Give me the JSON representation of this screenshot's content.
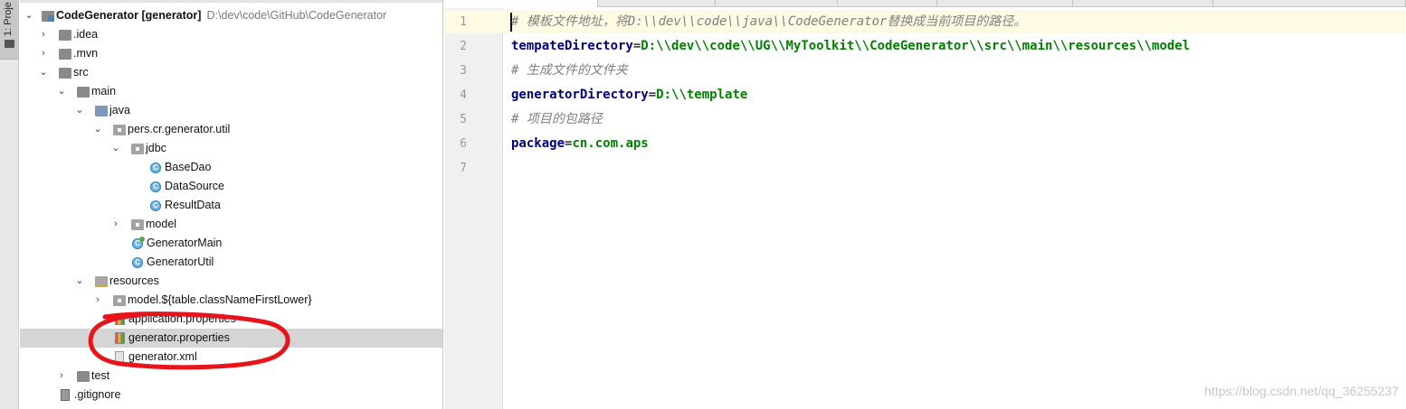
{
  "toolstrip": {
    "project_tab_label": "1: Proje"
  },
  "tree": {
    "root": {
      "name": "CodeGenerator",
      "module": "[generator]",
      "path": "D:\\dev\\code\\GitHub\\CodeGenerator"
    },
    "items": [
      {
        "label": ".idea"
      },
      {
        "label": ".mvn"
      },
      {
        "label": "src"
      },
      {
        "label": "main"
      },
      {
        "label": "java"
      },
      {
        "label": "pers.cr.generator.util"
      },
      {
        "label": "jdbc"
      },
      {
        "label": "BaseDao"
      },
      {
        "label": "DataSource"
      },
      {
        "label": "ResultData"
      },
      {
        "label": "model"
      },
      {
        "label": "GeneratorMain"
      },
      {
        "label": "GeneratorUtil"
      },
      {
        "label": "resources"
      },
      {
        "label": "model.${table.classNameFirstLower}"
      },
      {
        "label": "application.properties"
      },
      {
        "label": "generator.properties"
      },
      {
        "label": "generator.xml"
      },
      {
        "label": "test"
      },
      {
        "label": ".gitignore"
      }
    ],
    "selected": "generator.properties"
  },
  "editor": {
    "line_numbers": [
      "1",
      "2",
      "3",
      "4",
      "5",
      "6",
      "7"
    ],
    "lines": [
      {
        "comment": "# 模板文件地址，将D:\\\\dev\\\\code\\\\java\\\\CodeGenerator替换成当前项目的路径。"
      },
      {
        "key": "tempateDirectory",
        "eq": "=",
        "value": "D:\\\\dev\\\\code\\\\UG\\\\MyToolkit\\\\CodeGenerator\\\\src\\\\main\\\\resources\\\\model"
      },
      {
        "comment": "# 生成文件的文件夹"
      },
      {
        "key": "generatorDirectory",
        "eq": "=",
        "value": "D:\\\\template"
      },
      {
        "comment": "# 项目的包路径"
      },
      {
        "key": "package",
        "eq": "=",
        "value": "cn.com.aps"
      }
    ]
  },
  "watermark": "https://blog.csdn.net/qq_36255237",
  "colors": {
    "comment": "#808080",
    "key": "#000080",
    "value": "#008000",
    "selection": "#d5d5d5",
    "annotation": "#e8141c"
  }
}
